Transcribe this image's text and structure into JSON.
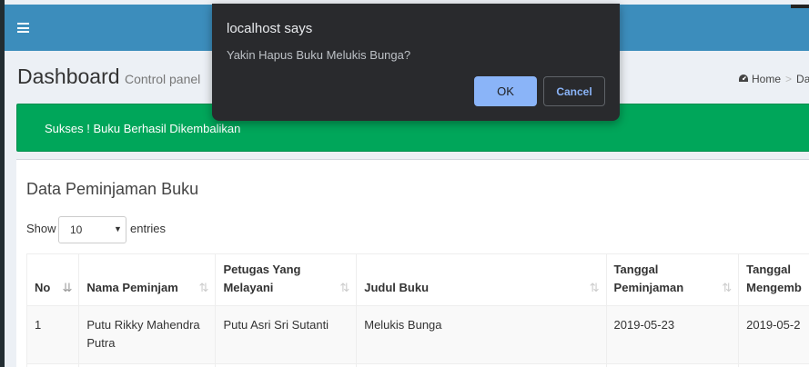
{
  "header": {
    "menu_icon": "hamburger-icon"
  },
  "content_header": {
    "title": "Dashboard",
    "subtitle": "Control panel",
    "breadcrumb": {
      "home_icon": "dashboard-icon",
      "home": "Home",
      "separator": ">",
      "current": "Da"
    }
  },
  "alert": {
    "text": "Sukses ! Buku Berhasil Dikembalikan"
  },
  "box": {
    "title": "Data Peminjaman Buku",
    "length": {
      "show_label": "Show",
      "selected": "10",
      "entries_label": "entries"
    }
  },
  "table": {
    "columns": [
      {
        "label": "No",
        "label2": ""
      },
      {
        "label": "Nama Peminjam",
        "label2": ""
      },
      {
        "label": "Petugas Yang",
        "label2": "Melayani"
      },
      {
        "label": "Judul Buku",
        "label2": ""
      },
      {
        "label": "Tanggal",
        "label2": "Peminjaman"
      },
      {
        "label": "Tanggal",
        "label2": "Mengemb"
      }
    ],
    "rows": [
      [
        "1",
        "Putu Rikky Mahendra Putra",
        "Putu Asri Sri Sutanti",
        "Melukis Bunga",
        "2019-05-23",
        "2019-05-2"
      ]
    ]
  },
  "dialog": {
    "title": "localhost says",
    "message": "Yakin Hapus Buku Melukis Bunga?",
    "ok_label": "OK",
    "cancel_label": "Cancel"
  },
  "colors": {
    "header": "#3c8dbc",
    "alert": "#00a65a",
    "dialog_bg": "#292a2d",
    "dialog_ok": "#8ab4f8"
  }
}
